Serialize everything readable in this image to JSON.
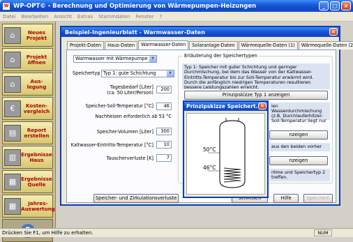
{
  "app": {
    "title": "WP-OPT© - Berechnung und Optimierung von Wärmepumpen-Heizungen"
  },
  "menu": [
    "Datei",
    "Bearbeiten",
    "Ansicht",
    "Extras",
    "Stammdaten",
    "Fenster",
    "?"
  ],
  "sidebar": [
    {
      "label": "Neues Projekt",
      "icon": "house-icon"
    },
    {
      "label": "Projekt öffnen",
      "icon": "house-open-icon"
    },
    {
      "label": "Aus-legung",
      "icon": "house-design-icon"
    },
    {
      "label": "Kosten-vergleich",
      "icon": "money-icon"
    },
    {
      "label": "Report erstellen",
      "icon": "report-icon"
    },
    {
      "label": "Ergebnisse Haus",
      "icon": "chart-house-icon"
    },
    {
      "label": "Ergebnisse Quelle",
      "icon": "chart-source-icon"
    },
    {
      "label": "Jahres-Auswertung",
      "icon": "calendar-icon"
    }
  ],
  "status": {
    "text": "Drücken Sie F1, um Hilfe zu erhalten.",
    "num": "NUM"
  },
  "dialog": {
    "title": "Beispiel-Ingenieurblatt - Warmwasser-Daten",
    "tabs": [
      "Projekt-Daten",
      "Haus-Daten",
      "Warmwasser-Daten",
      "Solaranlage-Daten",
      "Wärmequelle-Daten (1)",
      "Wärmequelle-Daten (2)"
    ],
    "mode_select": "Warmwasser mit Wärmepumpe",
    "speichertyp_label": "Speichertyp",
    "speichertyp_value": "Typ 1: gute Schichtung",
    "fields": [
      {
        "label": "Tagesbedarf [Liter]\n(ca. 50 Liter/Person)",
        "value": "200"
      },
      {
        "label": "Speicher-Soll-Temperatur [°C]",
        "value": "46"
      },
      {
        "label": "Speicher-Volumen [Liter]",
        "value": "300"
      },
      {
        "label": "Kaltwasser-Eintritts-Temperatur [°C]",
        "value": "10"
      },
      {
        "label": "Tauscherverluste [K]",
        "value": "7"
      }
    ],
    "nachheizen_text": "Nachheizen erforderlich ab 53 °C",
    "group_title": "Erläuterung der Speichertypen",
    "info1": "Typ 1: Speicher mit guter Schichtung und geringer Durchmischung, bei dem das Wasser von der Kaltwasser-Eintritts-Temperatur bis zur Soll-Temperatur erwärmt wird. Durch die anfänglich niedrigen Temperaturen resultieren bessere Leistungszahlen erreicht.",
    "btn_prinzip1": "Prinzipskizze Typ 1 anzeigen",
    "info2a": "len Wasserdurchmischung",
    "info2b": "(z.B. Durchlauferhitzer-",
    "info2c": "Soll-Temperatur liegt nur",
    "btn_anzeigen2": "nzeigen",
    "info3": "aus den beiden vorher",
    "btn_anzeigen3": "nzeigen",
    "info4a": "röme und Speichertyp 2",
    "info4b": "treffen.",
    "btn_verluste": "Speicher- und Zirkulationsverluste",
    "btn_close": "Schließen",
    "btn_help": "Hilfe",
    "btn_save": "Speichern"
  },
  "sketch": {
    "title": "Prinzipskizze Speichert...",
    "temp_top": "50°C",
    "temp_bottom": "46°C"
  }
}
